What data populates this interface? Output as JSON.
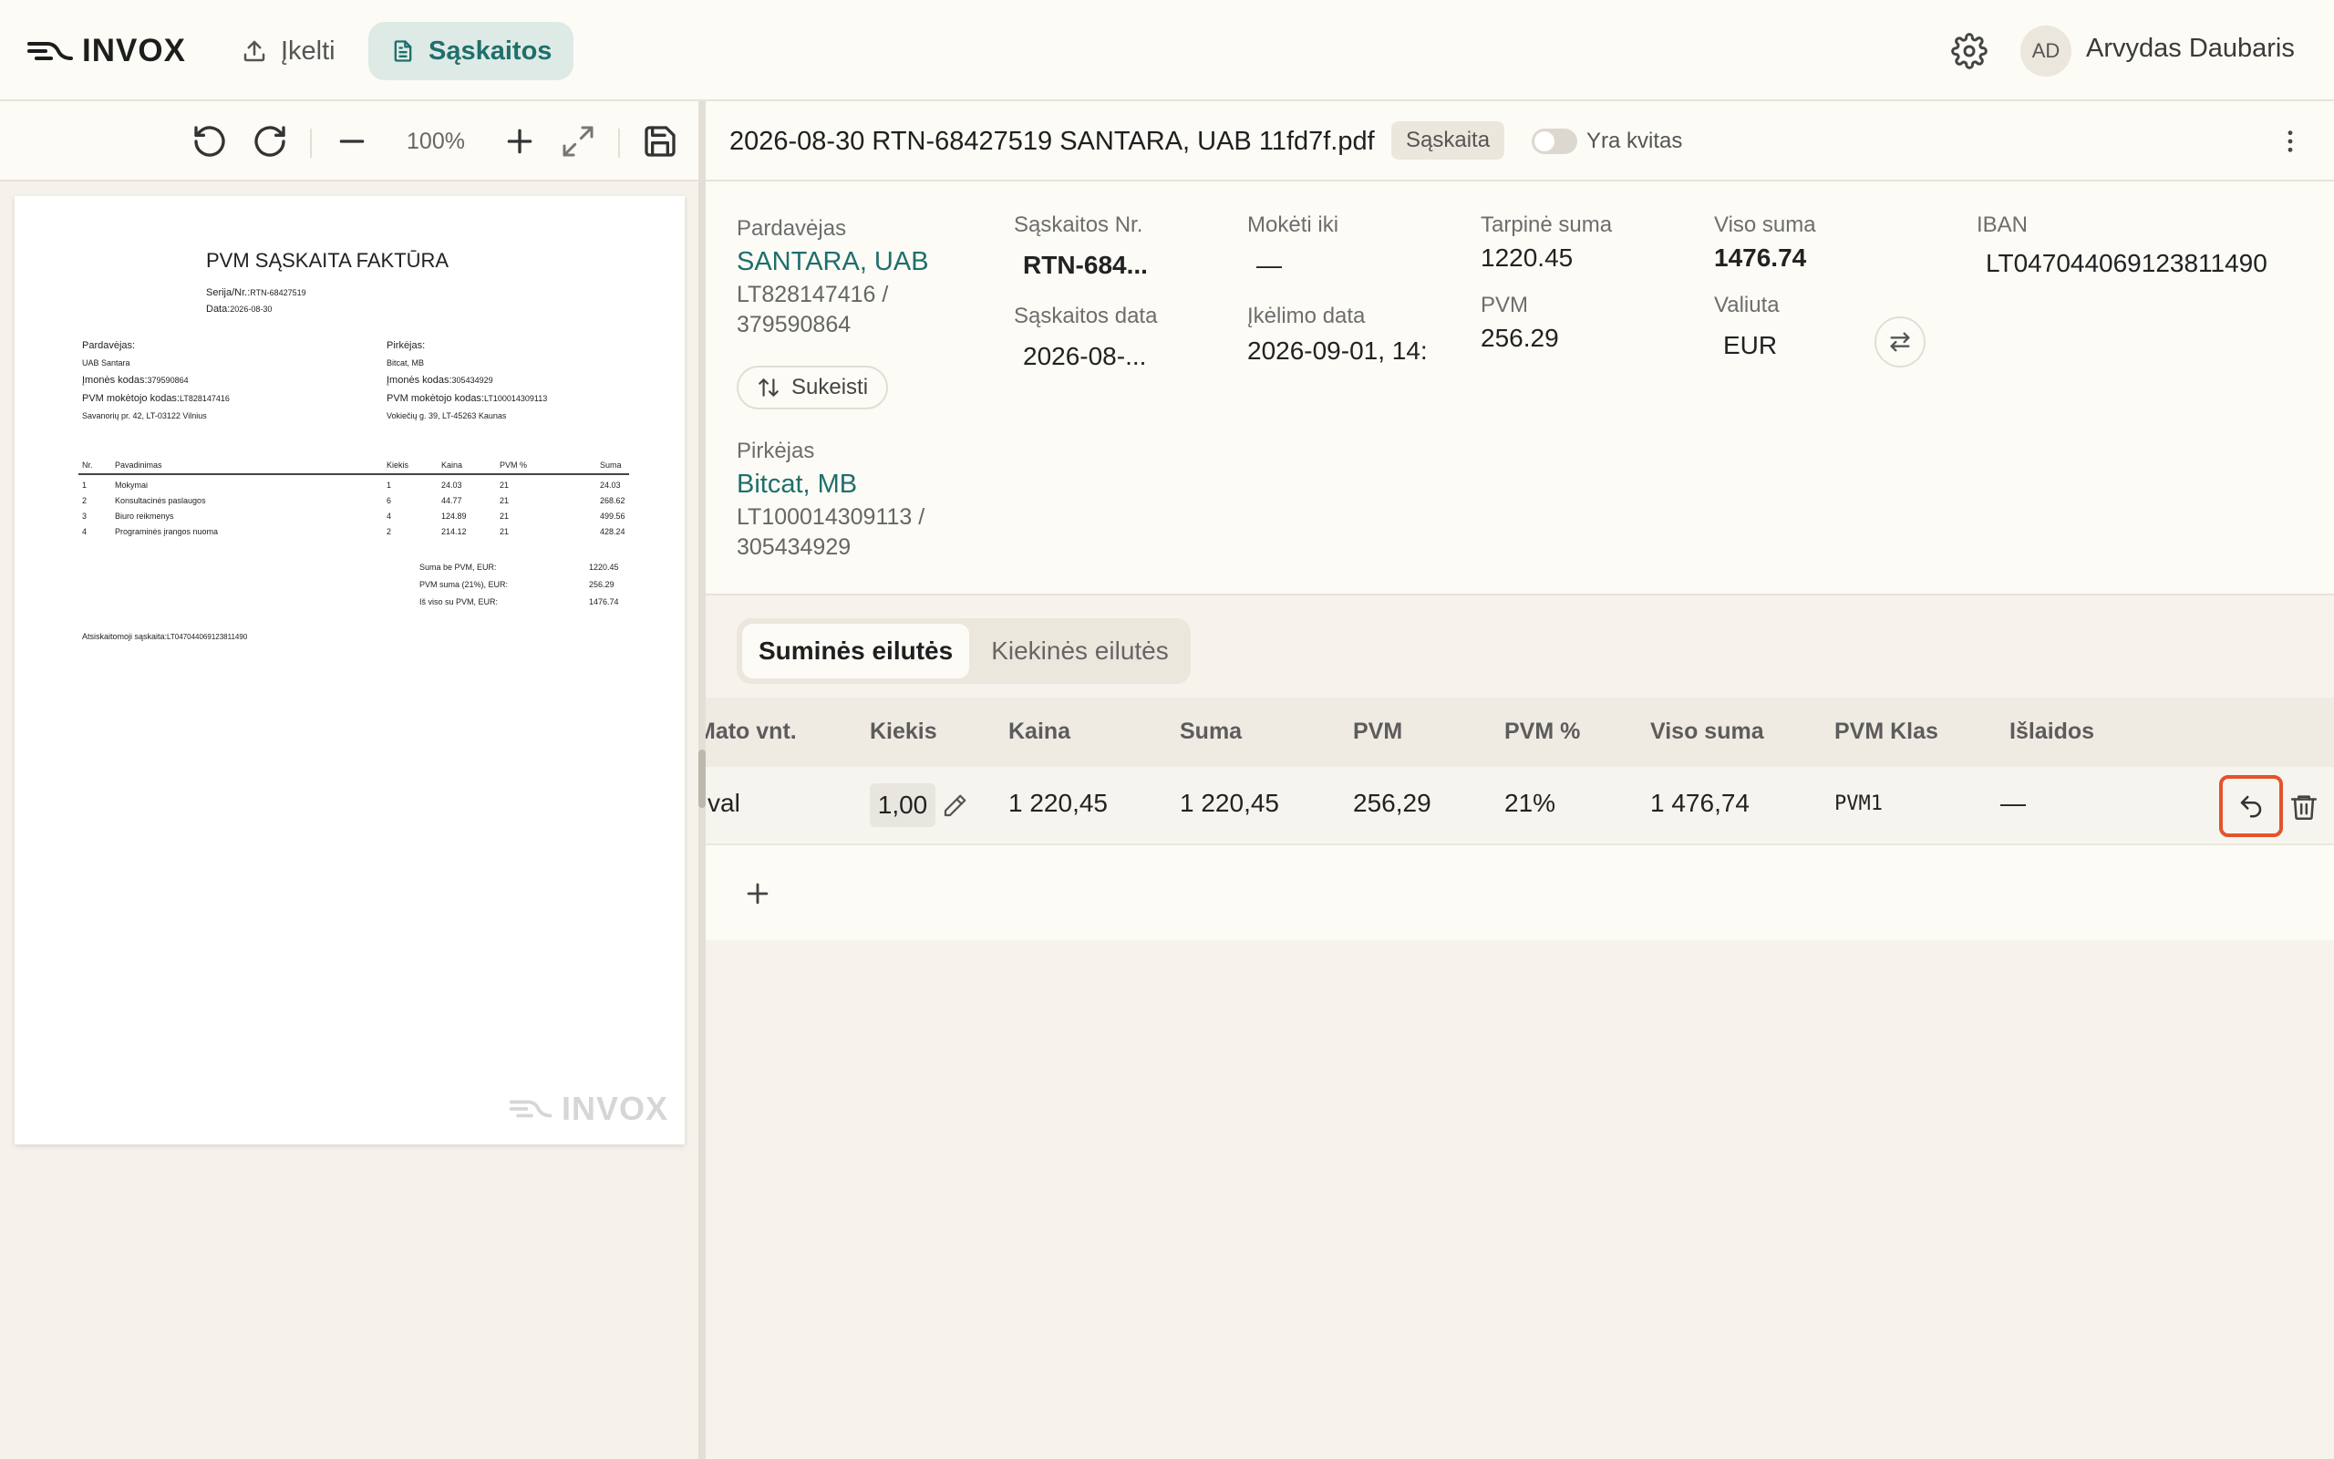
{
  "app": {
    "name": "INVOX"
  },
  "nav": {
    "upload_label": "Įkelti",
    "invoices_label": "Sąskaitos"
  },
  "user": {
    "initials": "AD",
    "name": "Arvydas Daubaris"
  },
  "pdf_toolbar": {
    "zoom": "100%"
  },
  "pdf": {
    "title": "PVM SĄSKAITA FAKTŪRA",
    "series_label": "Serija/Nr.:",
    "series_value": "RTN-68427519",
    "date_label": "Data:",
    "date_value": "2026-08-30",
    "seller_heading": "Pardavėjas:",
    "seller_name": "UAB Santara",
    "seller_code_label": "Įmonės kodas:",
    "seller_code": "379590864",
    "seller_vat_label": "PVM mokėtojo kodas:",
    "seller_vat": "LT828147416",
    "seller_address": "Savanorių pr. 42, LT-03122 Vilnius",
    "buyer_heading": "Pirkėjas:",
    "buyer_name": "Bitcat, MB",
    "buyer_code_label": "Įmonės kodas:",
    "buyer_code": "305434929",
    "buyer_vat_label": "PVM mokėtojo kodas:",
    "buyer_vat": "LT100014309113",
    "buyer_address": "Vokiečių g. 39, LT-45263 Kaunas",
    "table_headers": [
      "Nr.",
      "Pavadinimas",
      "Kiekis",
      "Kaina",
      "PVM %",
      "Suma"
    ],
    "rows": [
      [
        "1",
        "Mokymai",
        "1",
        "24.03",
        "21",
        "24.03"
      ],
      [
        "2",
        "Konsultacinės paslaugos",
        "6",
        "44.77",
        "21",
        "268.62"
      ],
      [
        "3",
        "Biuro reikmenys",
        "4",
        "124.89",
        "21",
        "499.56"
      ],
      [
        "4",
        "Programinės įrangos nuoma",
        "2",
        "214.12",
        "21",
        "428.24"
      ]
    ],
    "total_excl_label": "Suma be PVM, EUR:",
    "total_excl": "1220.45",
    "vat_label": "PVM suma (21%), EUR:",
    "vat": "256.29",
    "total_label": "Iš viso su PVM, EUR:",
    "total": "1476.74",
    "account_label": "Atsiskaitomoji sąskaita:",
    "account": "LT047044069123811490",
    "watermark": "INVOX"
  },
  "document": {
    "filename": "2026-08-30 RTN-68427519 SANTARA, UAB 11fd7f.pdf",
    "type_badge": "Sąskaita",
    "receipt_toggle_label": "Yra kvitas",
    "receipt_toggle_on": false
  },
  "details": {
    "seller_label": "Pardavėjas",
    "seller_name": "SANTARA, UAB",
    "seller_codes_line1": "LT828147416 /",
    "seller_codes_line2": "379590864",
    "swap_label": "Sukeisti",
    "buyer_label": "Pirkėjas",
    "buyer_name": "Bitcat, MB",
    "buyer_codes_line1": "LT100014309113 /",
    "buyer_codes_line2": "305434929",
    "invoice_no_label": "Sąskaitos Nr.",
    "invoice_no": "RTN-684...",
    "invoice_date_label": "Sąskaitos data",
    "invoice_date": "2026-08-...",
    "due_label": "Mokėti iki",
    "due_value": "—",
    "upload_date_label": "Įkėlimo data",
    "upload_date": "2026-09-01, 14:",
    "subtotal_label": "Tarpinė suma",
    "subtotal": "1220.45",
    "vat_label": "PVM",
    "vat": "256.29",
    "total_label": "Viso suma",
    "total": "1476.74",
    "currency_label": "Valiuta",
    "currency": "EUR",
    "iban_label": "IBAN",
    "iban": "LT047044069123811490"
  },
  "tabs": {
    "sum_lines": "Suminės eilutės",
    "qty_lines": "Kiekinės eilutės",
    "active": "sum_lines"
  },
  "table": {
    "headers": {
      "unit": "Mato vnt.",
      "qty": "Kiekis",
      "price": "Kaina",
      "sum": "Suma",
      "vat": "PVM",
      "vat_pct": "PVM %",
      "total": "Viso suma",
      "vat_class": "PVM Klas",
      "expenses": "Išlaidos"
    },
    "row": {
      "unit": "val",
      "qty": "1,00",
      "price": "1 220,45",
      "sum": "1 220,45",
      "vat": "256,29",
      "vat_pct": "21%",
      "total": "1 476,74",
      "vat_class": "PVM1",
      "expenses": "—"
    }
  },
  "colors": {
    "accent": "#1f6f6c",
    "highlight": "#e4532b",
    "background": "#f6f3ed"
  },
  "icons": [
    "upload-icon",
    "document-icon",
    "gear-icon",
    "rotate-left-icon",
    "rotate-right-icon",
    "minus-icon",
    "plus-icon",
    "expand-icon",
    "save-icon",
    "kebab-icon",
    "swap-vertical-icon",
    "swap-horizontal-icon",
    "pencil-icon",
    "undo-icon",
    "trash-icon",
    "add-icon"
  ]
}
